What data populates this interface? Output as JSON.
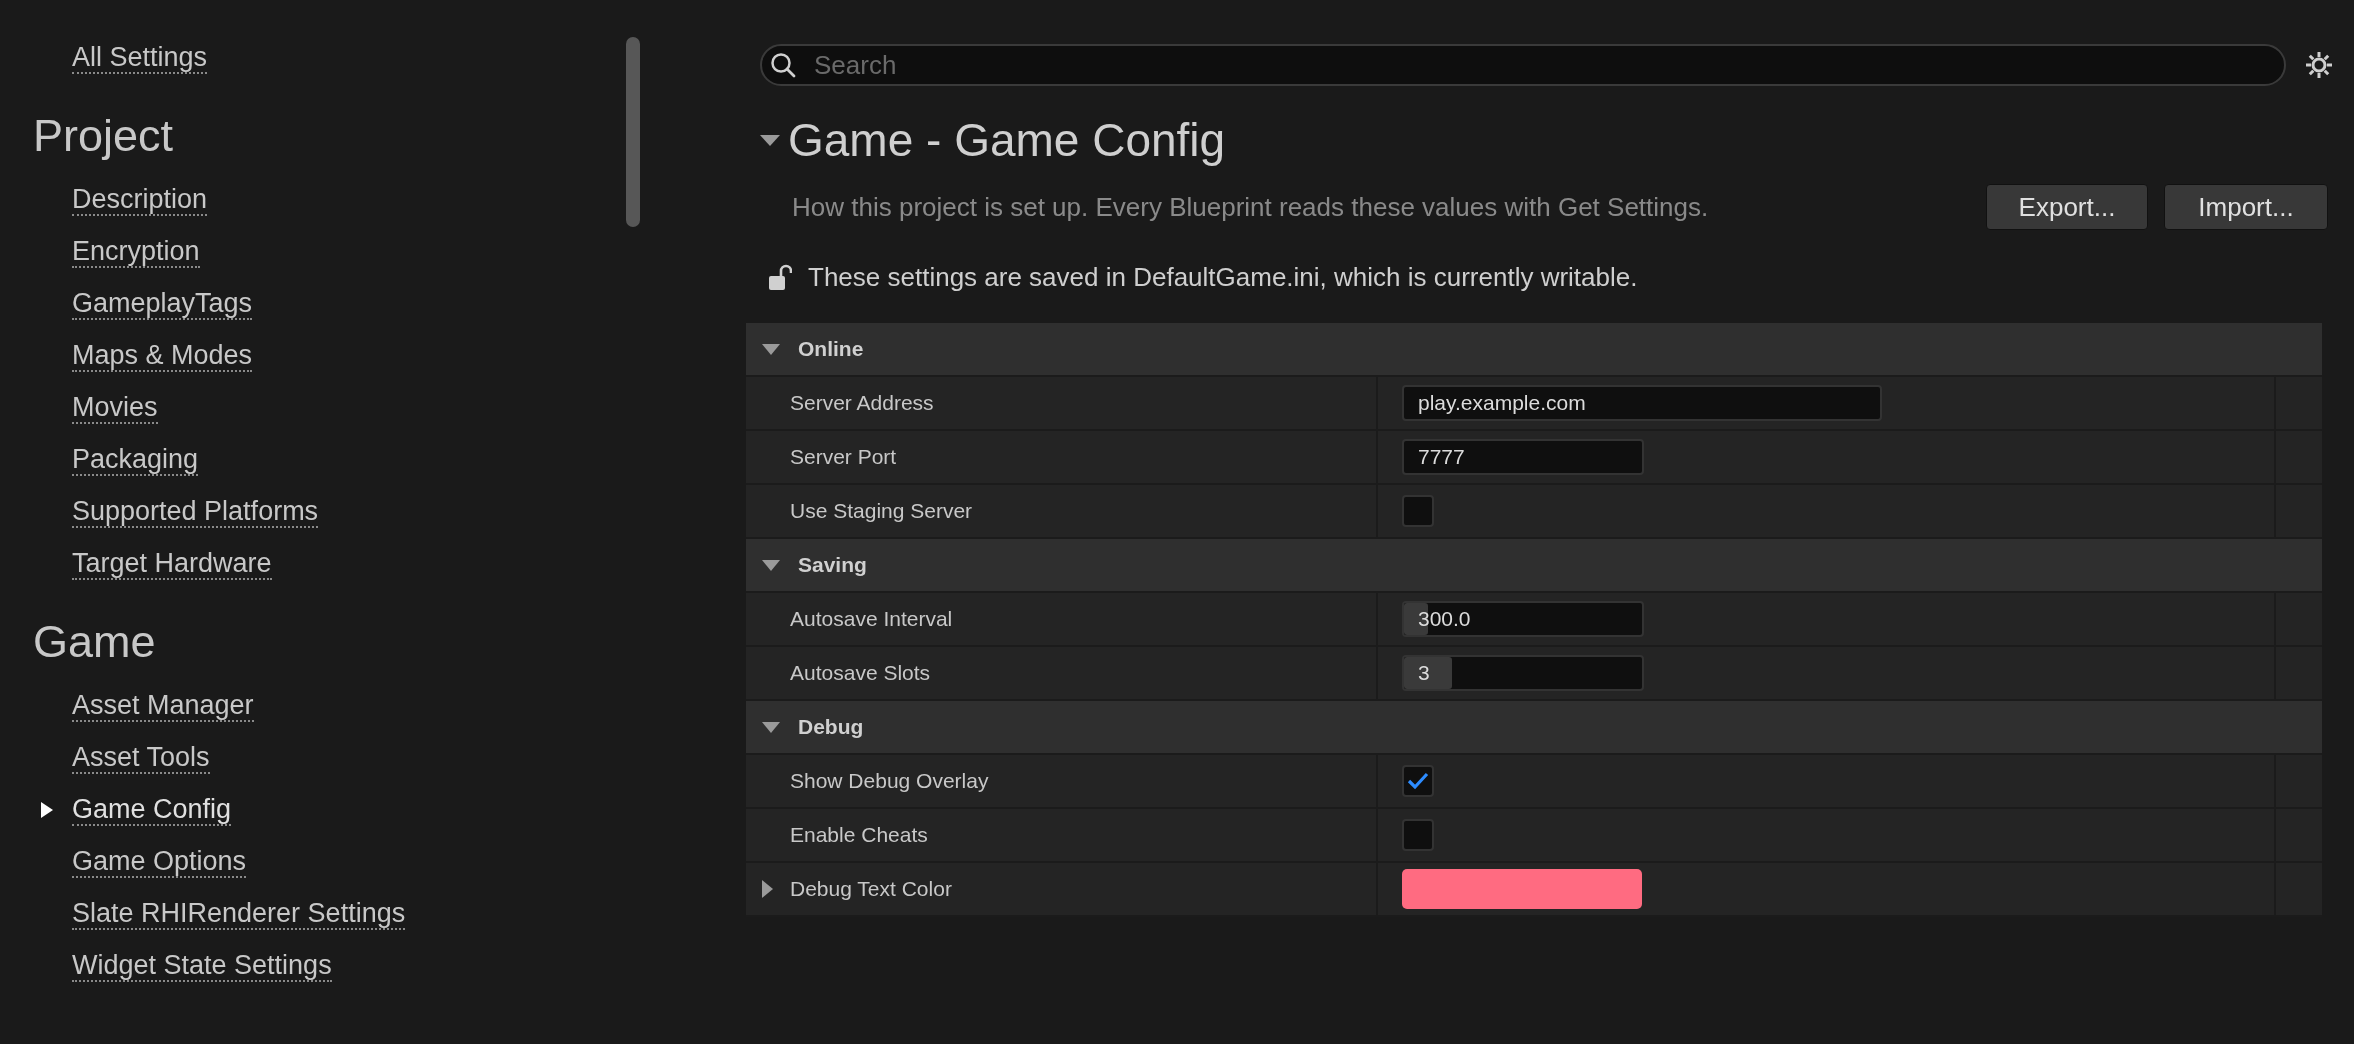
{
  "sidebar": {
    "top_link": "All Settings",
    "sections": [
      {
        "title": "Project",
        "items": [
          {
            "label": "Description",
            "selected": false
          },
          {
            "label": "Encryption",
            "selected": false
          },
          {
            "label": "GameplayTags",
            "selected": false
          },
          {
            "label": "Maps & Modes",
            "selected": false
          },
          {
            "label": "Movies",
            "selected": false
          },
          {
            "label": "Packaging",
            "selected": false
          },
          {
            "label": "Supported Platforms",
            "selected": false
          },
          {
            "label": "Target Hardware",
            "selected": false
          }
        ]
      },
      {
        "title": "Game",
        "items": [
          {
            "label": "Asset Manager",
            "selected": false
          },
          {
            "label": "Asset Tools",
            "selected": false
          },
          {
            "label": "Game Config",
            "selected": true
          },
          {
            "label": "Game Options",
            "selected": false
          },
          {
            "label": "Slate RHIRenderer Settings",
            "selected": false
          },
          {
            "label": "Widget State Settings",
            "selected": false
          }
        ]
      }
    ]
  },
  "search": {
    "placeholder": "Search"
  },
  "header": {
    "title": "Game - Game Config",
    "expanded": true,
    "description": "How this project is set up. Every Blueprint reads these values with Get Settings.",
    "buttons": [
      "Export...",
      "Import..."
    ],
    "notice": "These settings are saved in DefaultGame.ini, which is currently writable."
  },
  "categories": [
    {
      "name": "Online",
      "expanded": true,
      "properties": [
        {
          "kind": "text",
          "label": "Server Address",
          "value": "play.example.com"
        },
        {
          "kind": "text",
          "label": "Server Port",
          "value": "7777"
        },
        {
          "kind": "checkbox",
          "label": "Use Staging Server",
          "checked": false
        }
      ]
    },
    {
      "name": "Saving",
      "expanded": true,
      "properties": [
        {
          "kind": "number",
          "label": "Autosave Interval",
          "value": "300.0",
          "level": 0.1
        },
        {
          "kind": "number",
          "label": "Autosave Slots",
          "value": "3",
          "level": 0.2
        }
      ]
    },
    {
      "name": "Debug",
      "expanded": true,
      "properties": [
        {
          "kind": "checkbox",
          "label": "Show Debug Overlay",
          "checked": true
        },
        {
          "kind": "checkbox",
          "label": "Enable Cheats",
          "checked": false
        },
        {
          "kind": "color",
          "label": "Debug Text Color",
          "color": "#ff6b81",
          "expanded": false
        }
      ]
    }
  ]
}
